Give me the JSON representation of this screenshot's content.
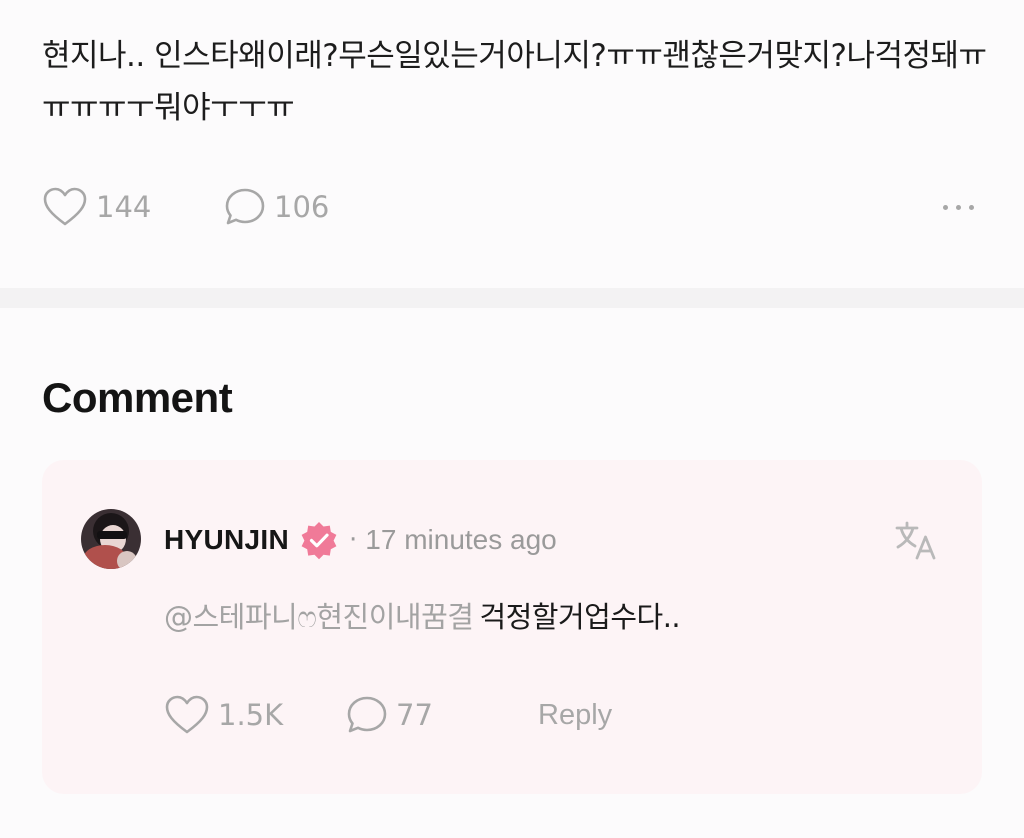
{
  "post": {
    "text": "현지나.. 인스타왜이래?무슨일있는거아니지?ㅠㅠ괜찮은거맞지?나걱정돼ㅠㅠㅠㅠㅜ뭐야ㅜㅜㅠ",
    "likes": "144",
    "comments": "106"
  },
  "comments_section": {
    "heading": "Comment",
    "items": [
      {
        "author": "HYUNJIN",
        "verified": true,
        "separator": "·",
        "timestamp": "17 minutes ago",
        "mention": "@스테파니ෆ현진이내꿈결",
        "text": "걱정할거업수다..",
        "likes": "1.5K",
        "replies": "77",
        "reply_label": "Reply"
      }
    ]
  },
  "icons": {
    "like": "heart-outline-icon",
    "comment": "speech-bubble-icon",
    "more": "more-horizontal-icon",
    "verified": "verified-badge-icon",
    "translate": "translate-icon"
  },
  "colors": {
    "muted": "#a7a7a7",
    "badge": "#f07a98",
    "card_bg": "#fdf4f6",
    "divider": "#f3f2f3"
  }
}
